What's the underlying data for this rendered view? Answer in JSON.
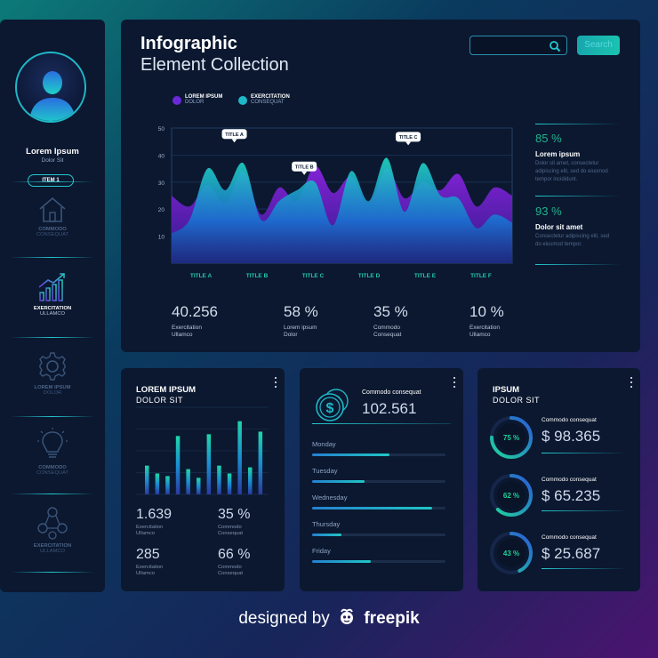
{
  "sidebar": {
    "user_name": "Lorem Ipsum",
    "user_subtitle": "Dolor Sit",
    "item_button": "ITEM 1",
    "items": [
      {
        "icon": "home-icon",
        "label1": "COMMODO",
        "label2": "CONSEQUAT",
        "active": false
      },
      {
        "icon": "growth-chart-icon",
        "label1": "EXERCITATION",
        "label2": "ULLAMCO",
        "active": true
      },
      {
        "icon": "gear-icon",
        "label1": "LOREM IPSUM",
        "label2": "DOLOR",
        "active": false
      },
      {
        "icon": "lightbulb-icon",
        "label1": "COMMODO",
        "label2": "CONSEQUAT",
        "active": false
      },
      {
        "icon": "network-users-icon",
        "label1": "EXERCITATION",
        "label2": "ULLAMCO",
        "active": false
      }
    ]
  },
  "header": {
    "title_line1": "Infographic",
    "title_line2": "Element Collection",
    "search_placeholder": "",
    "search_button": "Search"
  },
  "legend": [
    {
      "title": "LOREM IPSUM",
      "subtitle": "DOLOR",
      "color": "#6a2ad8"
    },
    {
      "title": "EXERCITATION",
      "subtitle": "CONSEQUAT",
      "color": "#1fb8c8"
    }
  ],
  "chart_data": {
    "type": "area",
    "categories": [
      "TITLE A",
      "TITLE B",
      "TITLE C",
      "TITLE D",
      "TITLE E",
      "TITLE F"
    ],
    "ylim": [
      0,
      50
    ],
    "yticks": [
      10,
      20,
      30,
      40,
      50
    ],
    "grid": true,
    "callouts": [
      {
        "label": "TITLE A",
        "x": 1.75,
        "y": 43
      },
      {
        "label": "TITLE B",
        "x": 3.7,
        "y": 31
      },
      {
        "label": "TITLE C",
        "x": 6.6,
        "y": 42
      }
    ],
    "series": [
      {
        "color": "#7a22d8",
        "x": [
          0,
          0.5,
          1,
          1.5,
          2,
          2.5,
          3,
          3.5,
          4,
          4.5,
          5,
          5.5,
          6,
          6.5,
          7,
          7.5,
          8,
          8.5,
          9,
          9.5
        ],
        "values": [
          25,
          21,
          29,
          22,
          34,
          18,
          28,
          23,
          36,
          26,
          32,
          22,
          35,
          24,
          30,
          27,
          33,
          21,
          28,
          25
        ]
      },
      {
        "color": "#1fb8c8",
        "x": [
          0,
          0.5,
          1,
          1.5,
          2,
          2.5,
          3,
          3.5,
          4,
          4.5,
          5,
          5.5,
          6,
          6.5,
          7,
          7.5,
          8,
          8.5,
          9,
          9.5
        ],
        "values": [
          11,
          16,
          35,
          27,
          37,
          16,
          23,
          27,
          30,
          14,
          34,
          23,
          39,
          19,
          37,
          25,
          24,
          13,
          18,
          15
        ]
      }
    ]
  },
  "main_stats": [
    {
      "value": "40.256",
      "label1": "Exercitation",
      "label2": "Ullamco"
    },
    {
      "value": "58 %",
      "label1": "Lorem ipsum",
      "label2": "Dolor"
    },
    {
      "value": "35 %",
      "label1": "Commodo",
      "label2": "Consequat"
    },
    {
      "value": "10 %",
      "label1": "Exercitation",
      "label2": "Ullamco"
    }
  ],
  "side_stats": [
    {
      "percent": "85 %",
      "title": "Lorem ipsum",
      "desc": "Dolor sit amet, consectetur adipiscing elit, sed do eiusmod tempor incididunt."
    },
    {
      "percent": "93 %",
      "title": "Dolor sit amet",
      "desc": "Consectetur adipiscing elit, sed do eiusmod tempor."
    }
  ],
  "card1": {
    "title": "LOREM IPSUM",
    "subtitle": "DOLOR SIT",
    "bars": [
      0.33,
      0.24,
      0.21,
      0.67,
      0.29,
      0.19,
      0.69,
      0.33,
      0.24,
      0.84,
      0.31,
      0.72
    ],
    "stats": [
      {
        "value": "1.639",
        "label1": "Exercitation",
        "label2": "Ullamco"
      },
      {
        "value": "35 %",
        "label1": "Commodo",
        "label2": "Consequat"
      },
      {
        "value": "285",
        "label1": "Exercitation",
        "label2": "Ullamco"
      },
      {
        "value": "66 %",
        "label1": "Commodo",
        "label2": "Consequat"
      }
    ]
  },
  "card2": {
    "label": "Commodo consequat",
    "value": "102.561",
    "days": [
      {
        "name": "Monday",
        "progress": 0.58
      },
      {
        "name": "Tuesday",
        "progress": 0.39
      },
      {
        "name": "Wednesday",
        "progress": 0.9
      },
      {
        "name": "Thursday",
        "progress": 0.22
      },
      {
        "name": "Friday",
        "progress": 0.44
      }
    ]
  },
  "card3": {
    "title": "IPSUM",
    "subtitle": "DOLOR SIT",
    "gauges": [
      {
        "percent": "75 %",
        "fraction": 0.75,
        "label": "Commodo consequat",
        "value": "$ 98.365"
      },
      {
        "percent": "62 %",
        "fraction": 0.62,
        "label": "Commodo consequat",
        "value": "$ 65.235"
      },
      {
        "percent": "43 %",
        "fraction": 0.43,
        "label": "Commodo consequat",
        "value": "$ 25.687"
      }
    ]
  },
  "footer": {
    "prefix": "designed by",
    "brand": "freepik"
  },
  "colors": {
    "accent": "#25c7d0",
    "purple": "#6a2ad8",
    "green": "#1fd19a",
    "panel": "#0b1830"
  }
}
